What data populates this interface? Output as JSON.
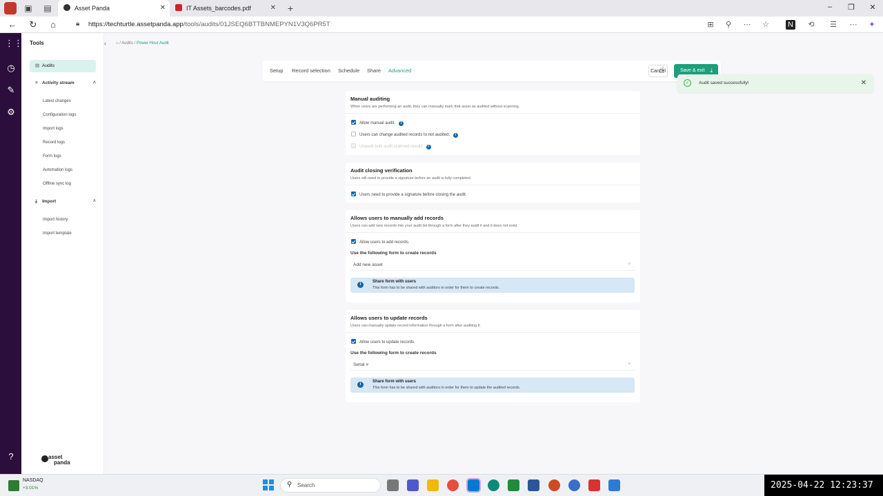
{
  "browser": {
    "tabs": [
      {
        "title": "Asset Panda",
        "active": true
      },
      {
        "title": "IT Assets_barcodes.pdf",
        "active": false
      }
    ],
    "url_host": "https://techturtle.assetpanda.app",
    "url_path": "/tools/audits/01JSEQ6BTTBNMEPYN1V3Q6PR5T"
  },
  "sidebar": {
    "title": "Tools",
    "active_item": "Audits",
    "groups": [
      {
        "label": "Activity stream",
        "items": [
          "Latest changes",
          "Configuration logs",
          "Import logs",
          "Record logs",
          "Form logs",
          "Automation logs",
          "Offline sync log"
        ]
      },
      {
        "label": "Import",
        "items": [
          "Import history",
          "Import template"
        ]
      }
    ],
    "logo_line1": "asset",
    "logo_line2": "panda"
  },
  "breadcrumb": {
    "parent": "Audits",
    "current": "Power Hour Audit"
  },
  "toolbar": {
    "tabs": [
      "Setup",
      "Record selection",
      "Schedule",
      "Share",
      "Advanced"
    ],
    "active_tab": "Advanced",
    "cancel_label": "Cancel",
    "save_label": "Save & exit"
  },
  "toast": {
    "message": "Audit saved successfully!"
  },
  "sections": {
    "manual": {
      "title": "Manual auditing",
      "desc": "When users are performing an audit, they can manually mark that asset as audited without scanning.",
      "opt1": "Allow manual audit.",
      "opt2": "Users can change audited records to not audited.",
      "opt3": "Unaudit bulk audit scanned results"
    },
    "closing": {
      "title": "Audit closing verification",
      "desc": "Users will need to provide a signature before an audit is fully completed.",
      "opt1": "Users need to provide a signature before closing the audit."
    },
    "add": {
      "title": "Allows users to manually add records",
      "desc": "Users can add new records into your audit list through a form after they audit it and it does not exist.",
      "opt1": "Allow users to add records.",
      "form_label": "Use the following form to create records",
      "form_value": "Add new asset",
      "banner_title": "Share form with users",
      "banner_text": "This form has to be shared with auditors in order for them to create records."
    },
    "update": {
      "title": "Allows users to update records",
      "desc": "Users can manually update record information through a form after auditing it.",
      "opt1": "Allow users to update records.",
      "form_label": "Use the following form to create records",
      "form_value": "Serial #",
      "banner_title": "Share form with users",
      "banner_text": "This form has to be shared with auditors in order for them to update the audited records."
    }
  },
  "taskbar": {
    "ticker_name": "NASDAQ",
    "ticker_change": "+3.01%",
    "search_placeholder": "Search",
    "clock": "2025-04-22  12:23:37"
  },
  "colors": {
    "accent": "#1c9f7c",
    "rail": "#2b0e3b",
    "info": "#1565a8",
    "banner": "#d6e7f5"
  }
}
